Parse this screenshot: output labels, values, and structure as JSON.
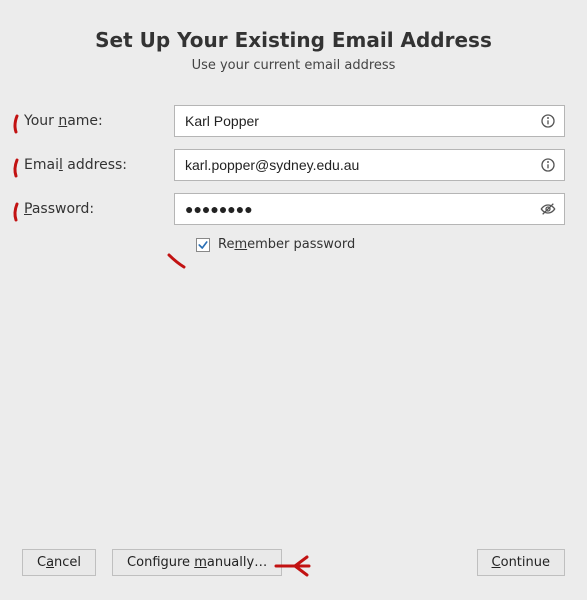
{
  "header": {
    "title": "Set Up Your Existing Email Address",
    "subtitle": "Use your current email address"
  },
  "fields": {
    "name": {
      "label_pre": "Your ",
      "label_ul": "n",
      "label_post": "ame:",
      "value": "Karl Popper"
    },
    "email": {
      "label_pre": "Emai",
      "label_ul": "l",
      "label_post": " address:",
      "value": "karl.popper@sydney.edu.au"
    },
    "password": {
      "label_ul": "P",
      "label_post": "assword:",
      "value": "●●●●●●●●"
    }
  },
  "remember": {
    "pre": "Re",
    "ul": "m",
    "post": "ember password",
    "checked": true
  },
  "buttons": {
    "cancel": {
      "pre": "C",
      "ul": "a",
      "post": "ncel"
    },
    "configure": {
      "pre": "Configure ",
      "ul": "m",
      "post": "anually…"
    },
    "continue": {
      "ul": "C",
      "post": "ontinue"
    }
  }
}
